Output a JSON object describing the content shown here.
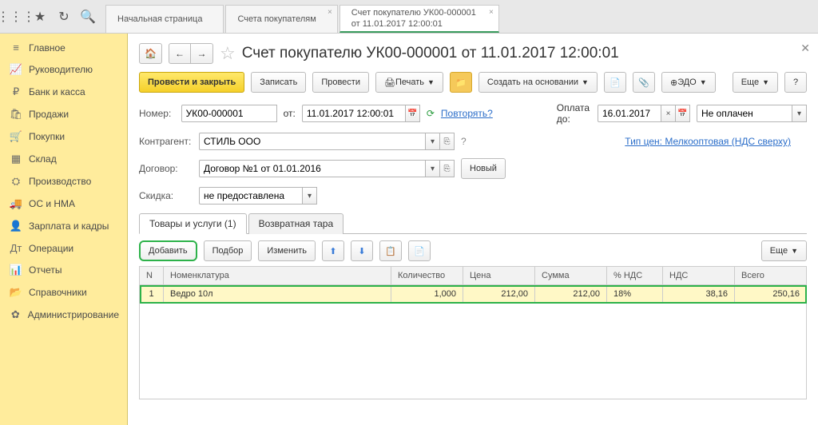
{
  "topTabs": [
    {
      "label": "Начальная страница",
      "active": false,
      "closable": false
    },
    {
      "label": "Счета покупателям",
      "active": false,
      "closable": true
    },
    {
      "label": "Счет покупателю УК00-000001 от 11.01.2017 12:00:01",
      "active": true,
      "closable": true
    }
  ],
  "sidebar": [
    {
      "icon": "≡",
      "label": "Главное"
    },
    {
      "icon": "📈",
      "label": "Руководителю"
    },
    {
      "icon": "₽",
      "label": "Банк и касса"
    },
    {
      "icon": "🛍",
      "label": "Продажи"
    },
    {
      "icon": "🛒",
      "label": "Покупки"
    },
    {
      "icon": "▦",
      "label": "Склад"
    },
    {
      "icon": "⛭",
      "label": "Производство"
    },
    {
      "icon": "🚚",
      "label": "ОС и НМА"
    },
    {
      "icon": "👤",
      "label": "Зарплата и кадры"
    },
    {
      "icon": "Дт",
      "label": "Операции"
    },
    {
      "icon": "📊",
      "label": "Отчеты"
    },
    {
      "icon": "📂",
      "label": "Справочники"
    },
    {
      "icon": "✿",
      "label": "Администрирование"
    }
  ],
  "pageTitle": "Счет покупателю УК00-000001 от 11.01.2017 12:00:01",
  "toolbar": {
    "postAndClose": "Провести и закрыть",
    "write": "Записать",
    "post": "Провести",
    "print": "Печать",
    "createBased": "Создать на основании",
    "edo": "ЭДО",
    "more": "Еще"
  },
  "form": {
    "numberLabel": "Номер:",
    "numberValue": "УК00-000001",
    "fromLabel": "от:",
    "fromValue": "11.01.2017 12:00:01",
    "repeatLink": "Повторять?",
    "payTillLabel": "Оплата до:",
    "payTillValue": "16.01.2017",
    "statusValue": "Не оплачен",
    "counterpartyLabel": "Контрагент:",
    "counterpartyValue": "СТИЛЬ ООО",
    "priceTypeLink": "Тип цен: Мелкооптовая (НДС сверху)",
    "contractLabel": "Договор:",
    "contractValue": "Договор №1 от 01.01.2016",
    "newBtn": "Новый",
    "discountLabel": "Скидка:",
    "discountValue": "не предоставлена"
  },
  "tabs": [
    {
      "label": "Товары и услуги (1)",
      "active": true
    },
    {
      "label": "Возвратная тара",
      "active": false
    }
  ],
  "tableToolbar": {
    "add": "Добавить",
    "pick": "Подбор",
    "edit": "Изменить",
    "more": "Еще"
  },
  "table": {
    "headers": [
      "N",
      "Номенклатура",
      "Количество",
      "Цена",
      "Сумма",
      "% НДС",
      "НДС",
      "Всего"
    ],
    "rows": [
      {
        "n": "1",
        "nom": "Ведро 10л",
        "qty": "1,000",
        "price": "212,00",
        "sum": "212,00",
        "vatp": "18%",
        "vat": "38,16",
        "total": "250,16"
      }
    ]
  }
}
